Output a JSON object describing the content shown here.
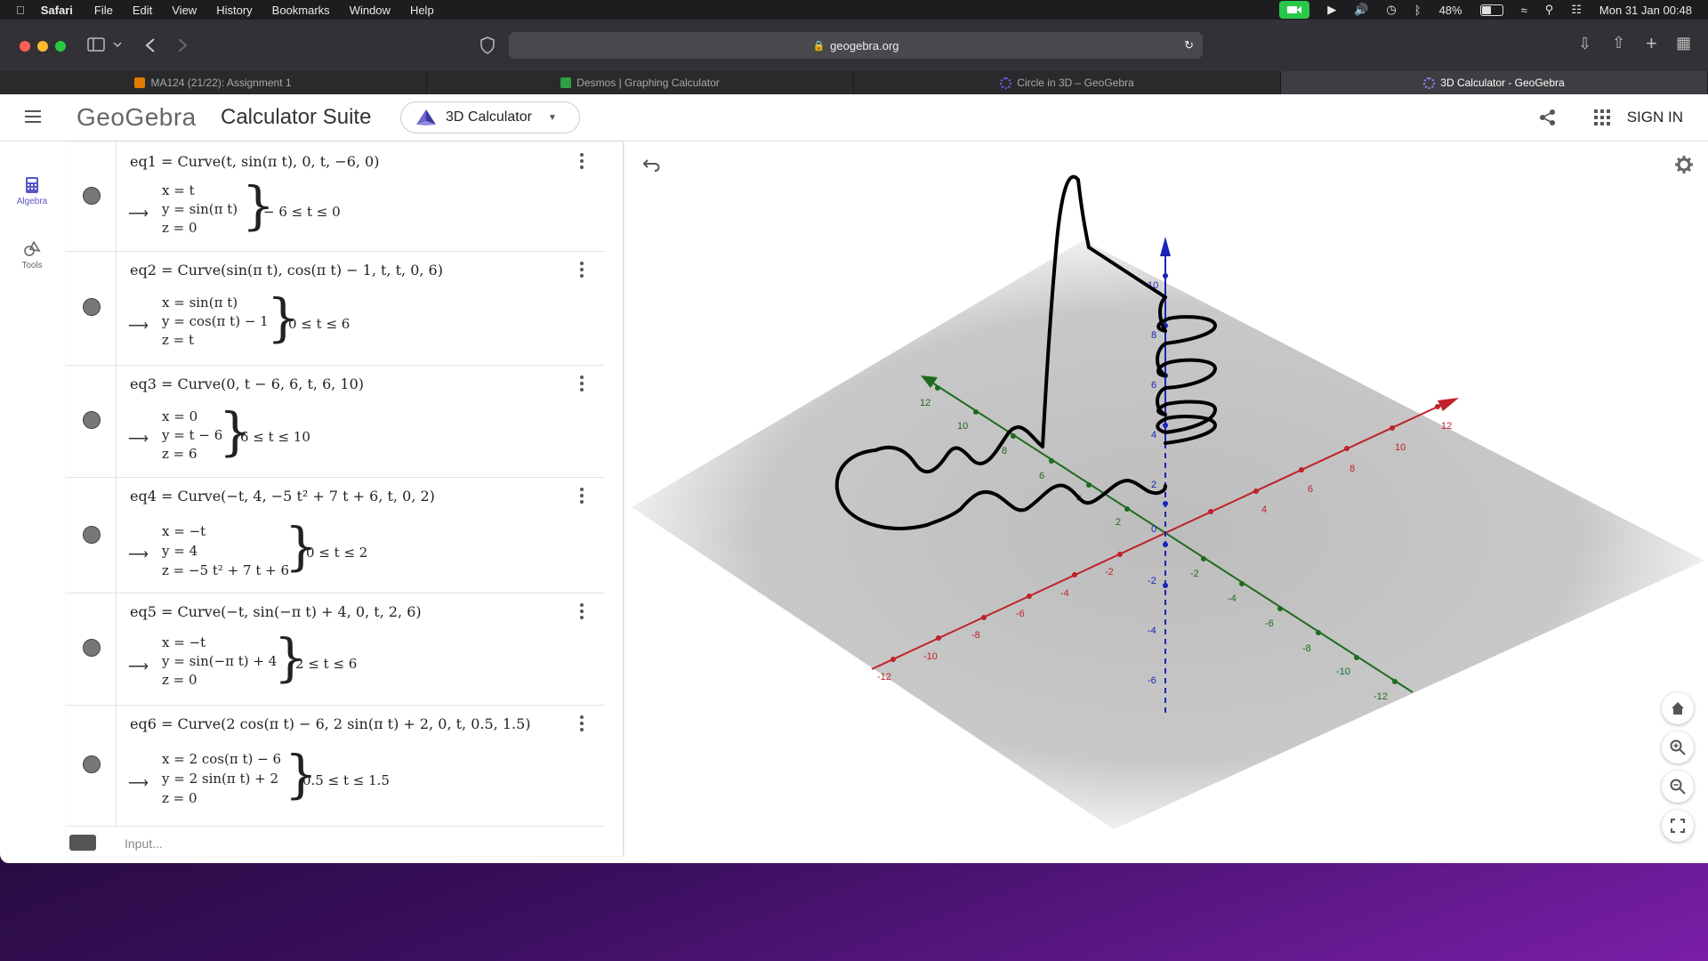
{
  "menubar": {
    "app": "Safari",
    "items": [
      "File",
      "Edit",
      "View",
      "History",
      "Bookmarks",
      "Window",
      "Help"
    ],
    "battery": "48%",
    "datetime": "Mon 31 Jan  00:48"
  },
  "browser": {
    "url": "geogebra.org",
    "tabs": [
      {
        "label": "MA124 (21/22): Assignment 1",
        "active": false,
        "fav_color": "#e07b00"
      },
      {
        "label": "Desmos | Graphing Calculator",
        "active": false,
        "fav_color": "#2f9e44"
      },
      {
        "label": "Circle in 3D – GeoGebra",
        "active": false,
        "fav_color": "#6c63ff"
      },
      {
        "label": "3D Calculator - GeoGebra",
        "active": true,
        "fav_color": "#6c63ff"
      }
    ]
  },
  "header": {
    "logo": "GeoGebra",
    "suite": "Calculator Suite",
    "calculator": "3D Calculator",
    "signin": "SIGN IN"
  },
  "rail": {
    "algebra": "Algebra",
    "tools": "Tools"
  },
  "algebra": {
    "equations": [
      {
        "def": "eq1 = Curve(t, sin(π t), 0, t, −6, 0)",
        "lines": [
          "x = t",
          "y = sin(π t)",
          "z = 0"
        ],
        "range": "− 6 ≤ t ≤ 0"
      },
      {
        "def": "eq2 = Curve(sin(π t), cos(π t) − 1, t, t, 0, 6)",
        "lines": [
          "x = sin(π t)",
          "y = cos(π t) − 1",
          "z = t"
        ],
        "range": "0 ≤ t ≤ 6"
      },
      {
        "def": "eq3 = Curve(0, t − 6, 6, t, 6, 10)",
        "lines": [
          "x = 0",
          "y = t − 6",
          "z = 6"
        ],
        "range": "6 ≤ t ≤ 10"
      },
      {
        "def": "eq4 = Curve(−t, 4, −5 t² + 7 t + 6, t, 0, 2)",
        "lines": [
          "x = −t",
          "y = 4",
          "z = −5 t² + 7 t + 6"
        ],
        "range": "0 ≤ t ≤ 2"
      },
      {
        "def": "eq5 = Curve(−t, sin(−π t) + 4, 0, t, 2, 6)",
        "lines": [
          "x = −t",
          "y = sin(−π t) + 4",
          "z = 0"
        ],
        "range": "2 ≤ t ≤ 6"
      },
      {
        "def": "eq6 = Curve(2 cos(π t) − 6, 2 sin(π t) + 2, 0, t, 0.5, 1.5)",
        "lines": [
          "x = 2 cos(π t) − 6",
          "y = 2 sin(π t) + 2",
          "z = 0"
        ],
        "range": "0.5 ≤ t ≤ 1.5"
      }
    ],
    "input_placeholder": "Input..."
  },
  "graphics": {
    "x_ticks": [
      "12",
      "10",
      "8",
      "6",
      "4",
      "-2",
      "-4",
      "-6",
      "-8",
      "-10",
      "-12"
    ],
    "y_ticks": [
      "12",
      "10",
      "8",
      "6",
      "4",
      "2",
      "-2",
      "-4",
      "-6",
      "-8",
      "-10",
      "-12"
    ],
    "z_ticks": [
      "10",
      "8",
      "6",
      "4",
      "2",
      "0",
      "-2",
      "-4",
      "-6"
    ],
    "colors": {
      "x_axis": "#c0202a",
      "y_axis": "#1e6b1e",
      "z_axis": "#1a24b8"
    }
  }
}
